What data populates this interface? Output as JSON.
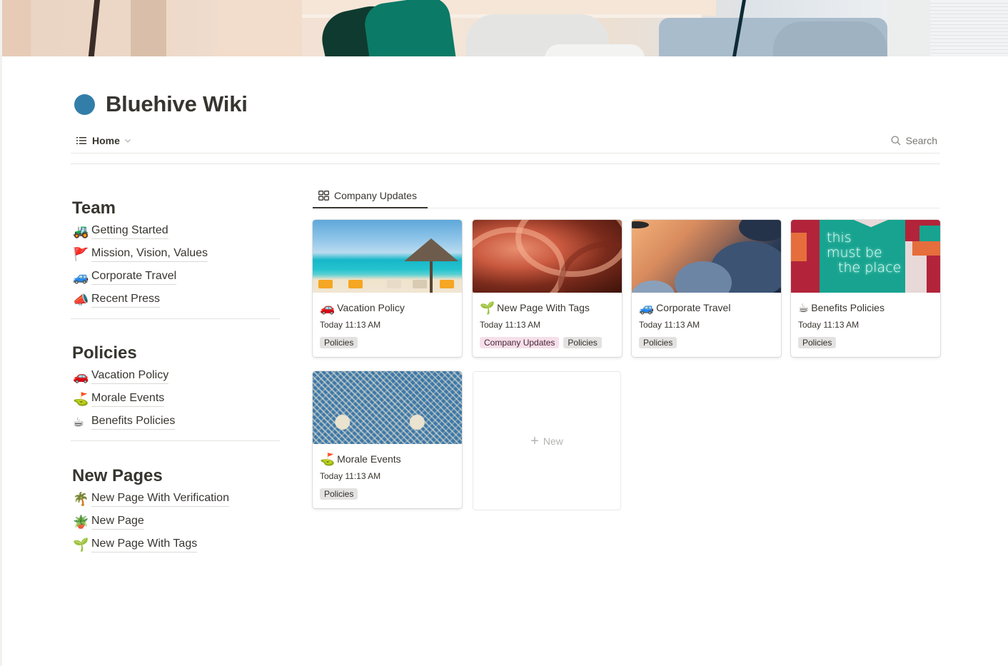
{
  "page": {
    "title": "Bluehive Wiki",
    "icon": "blue-circle-icon",
    "icon_color": "#337ea9"
  },
  "nav": {
    "home_label": "Home",
    "search_label": "Search"
  },
  "sections": [
    {
      "title": "Team",
      "items": [
        {
          "emoji": "🚜",
          "icon": "tractor-icon",
          "label": "Getting Started"
        },
        {
          "emoji": "🚩",
          "icon": "red-flag-icon",
          "label": "Mission, Vision, Values"
        },
        {
          "emoji": "🚙",
          "icon": "suv-car-icon",
          "label": "Corporate Travel"
        },
        {
          "emoji": "📣",
          "icon": "megaphone-icon",
          "label": "Recent Press"
        }
      ]
    },
    {
      "title": "Policies",
      "items": [
        {
          "emoji": "🚗",
          "icon": "red-car-icon",
          "label": "Vacation Policy"
        },
        {
          "emoji": "⛳",
          "icon": "golf-flag-icon",
          "label": "Morale Events"
        },
        {
          "emoji": "☕",
          "icon": "coffee-icon",
          "label": "Benefits Policies"
        }
      ]
    },
    {
      "title": "New Pages",
      "items": [
        {
          "emoji": "🌴",
          "icon": "palm-tree-icon",
          "label": "New Page With Verification"
        },
        {
          "emoji": "🪴",
          "icon": "potted-plant-icon",
          "label": "New Page"
        },
        {
          "emoji": "🌱",
          "icon": "seedling-icon",
          "label": "New Page With Tags"
        }
      ]
    }
  ],
  "gallery": {
    "tab_label": "Company Updates",
    "cards": [
      {
        "emoji": "🚗",
        "icon": "red-car-icon",
        "title": "Vacation Policy",
        "date": "Today 11:13 AM",
        "tags": [
          "Policies"
        ],
        "image": "beach"
      },
      {
        "emoji": "🌱",
        "icon": "seedling-icon",
        "title": "New Page With Tags",
        "date": "Today 11:13 AM",
        "tags": [
          "Company Updates",
          "Policies"
        ],
        "image": "canyon"
      },
      {
        "emoji": "🚙",
        "icon": "suv-car-icon",
        "title": "Corporate Travel",
        "date": "Today 11:13 AM",
        "tags": [
          "Policies"
        ],
        "image": "clouds"
      },
      {
        "emoji": "☕",
        "icon": "coffee-icon",
        "title": "Benefits Policies",
        "date": "Today 11:13 AM",
        "tags": [
          "Policies"
        ],
        "image": "neon-sign"
      },
      {
        "emoji": "⛳",
        "icon": "golf-flag-icon",
        "title": "Morale Events",
        "date": "Today 11:13 AM",
        "tags": [
          "Policies"
        ],
        "image": "floral-pattern"
      }
    ],
    "neon_text": [
      "this",
      "must be",
      "the place"
    ],
    "new_label": "New",
    "tag_colors": {
      "Policies": "#e3e2e0",
      "Company Updates": "#f5e0e9"
    }
  }
}
